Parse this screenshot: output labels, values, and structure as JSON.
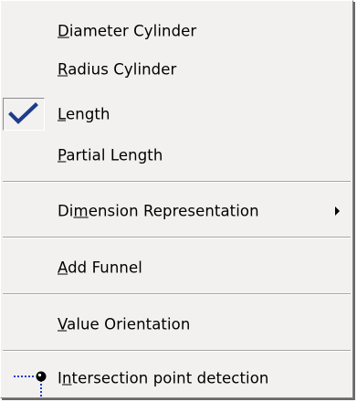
{
  "menu": {
    "items": [
      {
        "pre": "",
        "mnemonic": "D",
        "post": "iameter Cylinder",
        "checked": false,
        "submenu": false
      },
      {
        "pre": "",
        "mnemonic": "R",
        "post": "adius Cylinder",
        "checked": false,
        "submenu": false
      },
      {
        "pre": "",
        "mnemonic": "L",
        "post": "ength",
        "checked": true,
        "submenu": false
      },
      {
        "pre": "",
        "mnemonic": "P",
        "post": "artial Length",
        "checked": false,
        "submenu": false
      },
      {
        "pre": "Di",
        "mnemonic": "m",
        "post": "ension Representation",
        "checked": false,
        "submenu": true
      },
      {
        "pre": "",
        "mnemonic": "A",
        "post": "dd Funnel",
        "checked": false,
        "submenu": false
      },
      {
        "pre": "",
        "mnemonic": "V",
        "post": "alue Orientation",
        "checked": false,
        "submenu": false
      },
      {
        "pre": "I",
        "mnemonic": "n",
        "post": "tersection point detection",
        "checked": false,
        "submenu": false,
        "icon": "intersection-point-icon"
      }
    ],
    "icons": {
      "check": "checkmark-icon",
      "submenu": "submenu-arrow-icon"
    },
    "colors": {
      "background": "#f2f1f0",
      "check": "#1e3c8c",
      "icon_blue": "#1e3cd2"
    }
  }
}
